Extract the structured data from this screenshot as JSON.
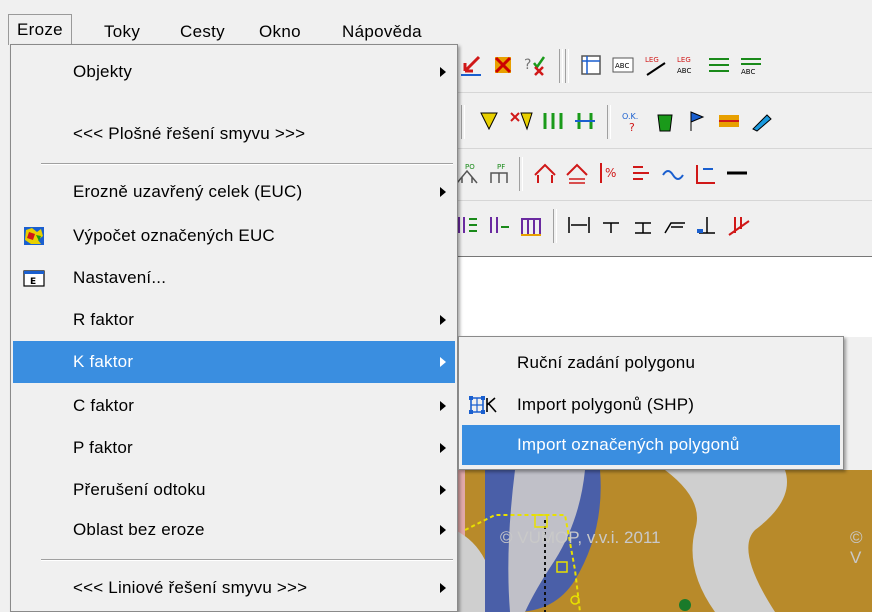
{
  "menubar": {
    "items": [
      {
        "label": "Eroze"
      },
      {
        "label": "Toky"
      },
      {
        "label": "Cesty"
      },
      {
        "label": "Okno"
      },
      {
        "label": "Nápověda"
      }
    ]
  },
  "eroze_menu": {
    "items": [
      {
        "label": "Objekty",
        "submenu": true
      },
      {
        "label": "<<< Plošné řešení smyvu >>>",
        "submenu": false
      },
      {
        "label": "Erozně uzavřený celek (EUC)",
        "submenu": true
      },
      {
        "label": "Výpočet označených EUC",
        "icon": "euc-map-icon"
      },
      {
        "label": "Nastavení...",
        "icon": "settings-e-icon"
      },
      {
        "label": "R faktor",
        "submenu": true
      },
      {
        "label": "K faktor",
        "submenu": true,
        "highlighted": true
      },
      {
        "label": "C faktor",
        "submenu": true
      },
      {
        "label": "P faktor",
        "submenu": true
      },
      {
        "label": "Přerušení odtoku",
        "submenu": true
      },
      {
        "label": "Oblast bez eroze",
        "submenu": true
      },
      {
        "label": "<<< Liniové řešení smyvu >>>",
        "submenu": true
      }
    ]
  },
  "k_faktor_submenu": {
    "items": [
      {
        "label": "Ruční zadání polygonu"
      },
      {
        "label": "Import polygonů (SHP)",
        "icon": "polygon-k-icon"
      },
      {
        "label": "Import označených polygonů",
        "highlighted": true
      }
    ]
  },
  "toolbar_text": {
    "ok": "O.K.",
    "po": "PO",
    "pf": "PF",
    "leg": "LEG",
    "abc": "ABC"
  },
  "map": {
    "watermark": "© VÚMOP, v.v.i. 2011",
    "watermark2": "© V"
  },
  "colors": {
    "highlight": "#3a8ee0",
    "menu_bg": "#f0f0f0",
    "map_brown": "#b88a2a",
    "map_blue": "#4a5fa8"
  }
}
